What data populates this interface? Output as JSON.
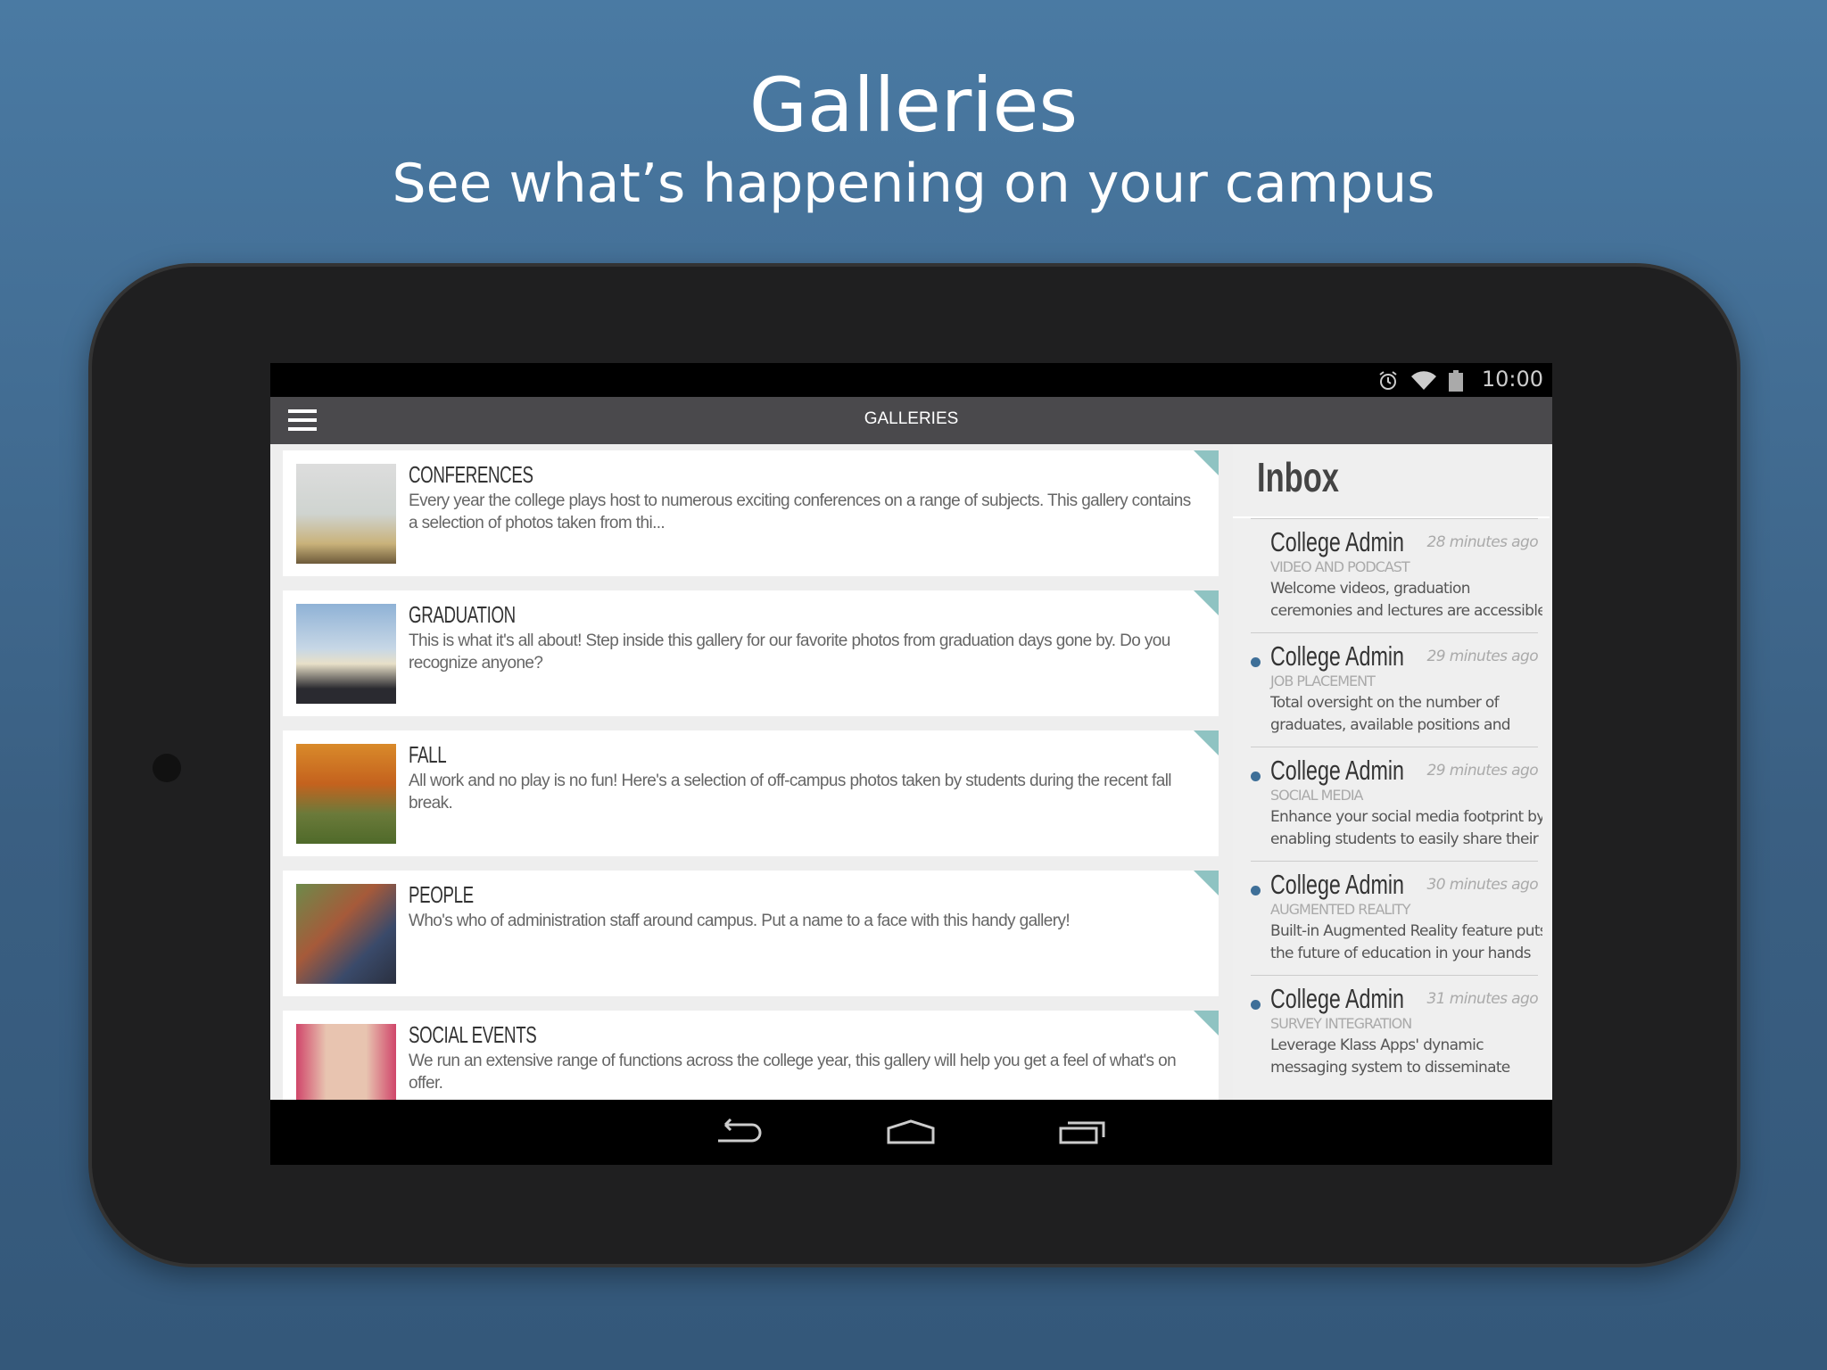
{
  "hero": {
    "title": "Galleries",
    "subtitle": "See what’s happening on your campus"
  },
  "status_bar": {
    "time": "10:00",
    "icons": [
      "alarm-icon",
      "wifi-icon",
      "battery-icon"
    ]
  },
  "action_bar": {
    "title": "GALLERIES",
    "menu_icon": "hamburger-icon"
  },
  "galleries": [
    {
      "title": "CONFERENCES",
      "description": "Every year the college plays host to numerous exciting conferences on a range of subjects.  This gallery contains a selection of photos taken from thi..."
    },
    {
      "title": "GRADUATION",
      "description": "This is what it's all about!  Step inside this gallery for our favorite photos from graduation days gone by.  Do you recognize anyone?"
    },
    {
      "title": "FALL",
      "description": "All work and no play is no fun!  Here's a selection of off-campus photos taken by students during the recent fall break."
    },
    {
      "title": "PEOPLE",
      "description": "Who's who of administration staff around campus.  Put a name to a face with this handy gallery!"
    },
    {
      "title": "SOCIAL EVENTS",
      "description": "We run an extensive range of functions across the college year, this gallery will help you get a feel of what's on offer."
    }
  ],
  "inbox": {
    "title": "Inbox",
    "messages": [
      {
        "sender": "College Admin",
        "time": "28 minutes ago",
        "category": "VIDEO AND PODCAST",
        "line1": "Welcome videos, graduation",
        "line2": "ceremonies and lectures are accessible",
        "unread": false
      },
      {
        "sender": "College Admin",
        "time": "29 minutes ago",
        "category": "JOB PLACEMENT",
        "line1": "Total oversight on the number of",
        "line2": "graduates, available positions and",
        "unread": true
      },
      {
        "sender": "College Admin",
        "time": "29 minutes ago",
        "category": "SOCIAL MEDIA",
        "line1": "Enhance your social media footprint by",
        "line2": "enabling students to easily share their",
        "unread": true
      },
      {
        "sender": "College Admin",
        "time": "30 minutes ago",
        "category": "AUGMENTED REALITY",
        "line1": "Built-in Augmented Reality feature puts",
        "line2": "the future of education in your hands",
        "unread": true
      },
      {
        "sender": "College Admin",
        "time": "31 minutes ago",
        "category": "SURVEY INTEGRATION",
        "line1": "Leverage Klass Apps' dynamic",
        "line2": "messaging system to disseminate",
        "unread": true
      }
    ]
  },
  "nav_bar": {
    "icons": [
      "back-icon",
      "home-icon",
      "recents-icon"
    ]
  },
  "colors": {
    "background": "#4a7aa3",
    "accent": "#8fc3c2",
    "unread_dot": "#3e6f98",
    "action_bar": "#4a494c"
  }
}
